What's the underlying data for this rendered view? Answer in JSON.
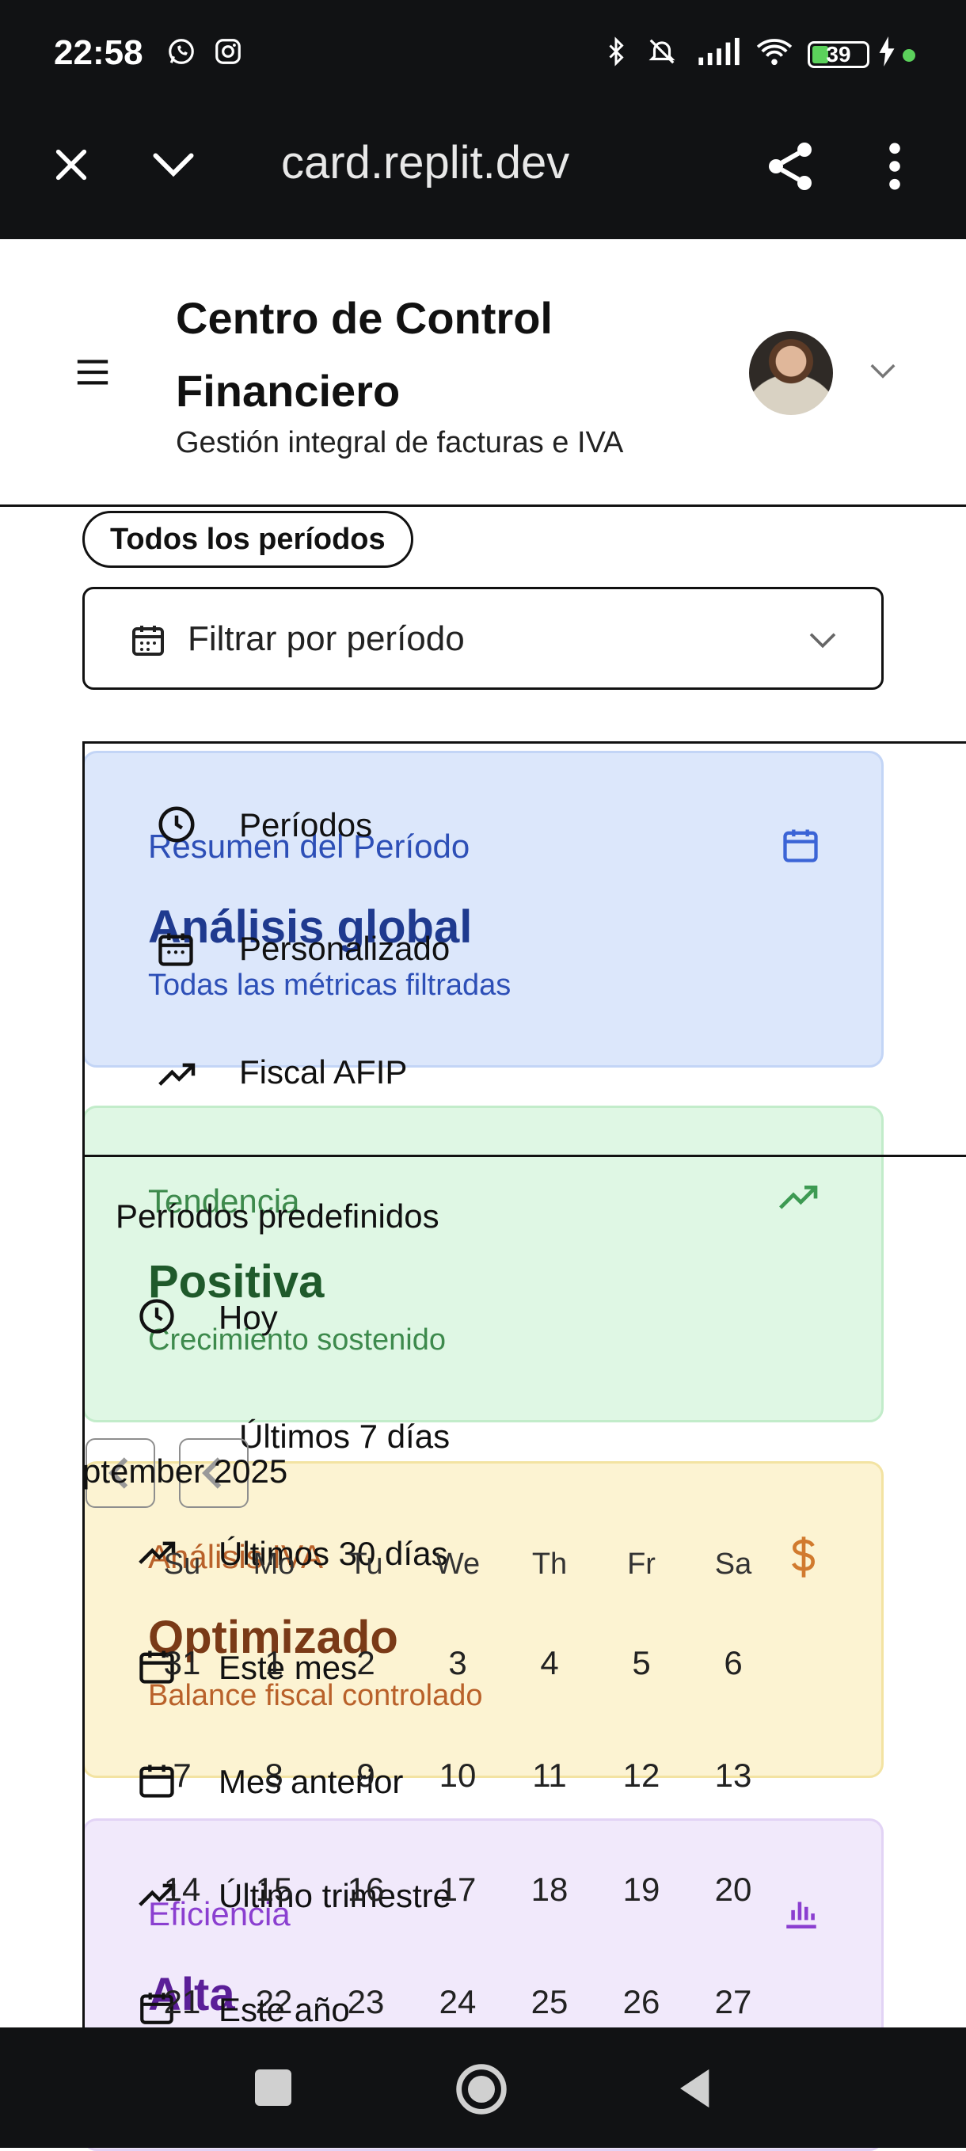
{
  "status_bar": {
    "time": "22:58",
    "battery": "39"
  },
  "browser": {
    "url": "card.replit.dev"
  },
  "header": {
    "title": "Centro de Control Financiero",
    "subtitle": "Gestión integral de facturas e IVA"
  },
  "filter": {
    "pill_label": "Todos los períodos",
    "select_label": "Filtrar por período"
  },
  "cards": [
    {
      "title": "Resumen del Período",
      "value": "Análisis global",
      "subtitle": "Todas las métricas filtradas"
    },
    {
      "title": "Tendencia",
      "value": "Positiva",
      "subtitle": "Crecimiento sostenido"
    },
    {
      "title": "Análisis IVA",
      "value": "Optimizado",
      "subtitle": "Balance fiscal controlado"
    },
    {
      "title": "Eficiencia",
      "value": "Alta"
    }
  ],
  "dropdown": {
    "tabs": [
      "Períodos",
      "Personalizado",
      "Fiscal AFIP"
    ],
    "section_title": "Períodos predefinidos",
    "presets": [
      "Hoy",
      "Últimos 7 días",
      "Últimos 30 días",
      "Este mes",
      "Mes anterior",
      "Último trimestre",
      "Este año"
    ]
  },
  "calendar": {
    "month_label": "ptember 2025",
    "weekdays": [
      "Su",
      "Mo",
      "Tu",
      "We",
      "Th",
      "Fr",
      "Sa"
    ],
    "weeks": [
      [
        "31",
        "1",
        "2",
        "3",
        "4",
        "5",
        "6"
      ],
      [
        "7",
        "8",
        "9",
        "10",
        "11",
        "12",
        "13"
      ],
      [
        "14",
        "15",
        "16",
        "17",
        "18",
        "19",
        "20"
      ],
      [
        "21",
        "22",
        "23",
        "24",
        "25",
        "26",
        "27"
      ]
    ]
  },
  "colors": {
    "blue_card": "#dce7fb",
    "green_card": "#dff7e4",
    "yellow_card": "#fcf3d2",
    "purple_card": "#f1e9fb"
  }
}
